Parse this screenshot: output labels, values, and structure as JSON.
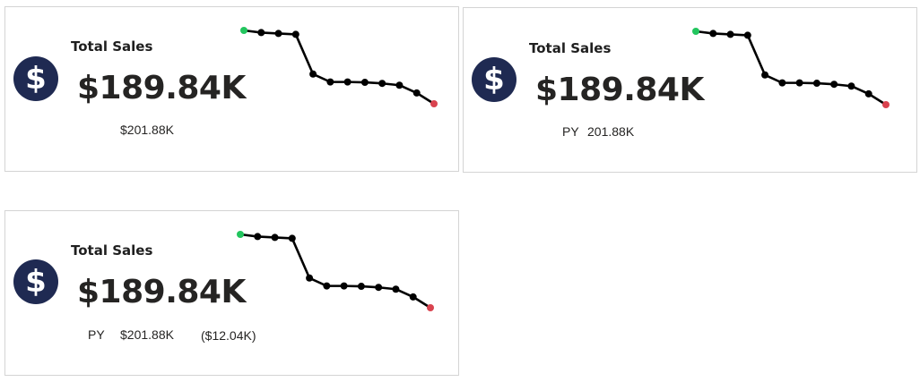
{
  "colors": {
    "icon_bg": "#1f2a52",
    "line": "#000000",
    "first_point": "#22c55e",
    "last_point": "#d9434f"
  },
  "cards": [
    {
      "icon": "dollar-icon",
      "icon_glyph": "$",
      "title": "Total Sales",
      "value": "$189.84K",
      "py_label": "",
      "py_value": "$201.88K",
      "variance": "",
      "sparkline": [
        100,
        98.8,
        98.3,
        97.8,
        75.8,
        71.4,
        71.4,
        71.2,
        70.6,
        69.6,
        65.3,
        59.3
      ]
    },
    {
      "icon": "dollar-icon",
      "icon_glyph": "$",
      "title": "Total Sales",
      "value": "$189.84K",
      "py_label": "PY",
      "py_value": "201.88K",
      "variance": "",
      "sparkline": [
        100,
        98.8,
        98.3,
        97.8,
        75.8,
        71.4,
        71.4,
        71.2,
        70.6,
        69.6,
        65.3,
        59.3
      ]
    },
    {
      "icon": "dollar-icon",
      "icon_glyph": "$",
      "title": "Total Sales",
      "value": "$189.84K",
      "py_label": "PY",
      "py_value": "$201.88K",
      "variance": "($12.04K)",
      "sparkline": [
        100,
        98.8,
        98.3,
        97.8,
        75.8,
        71.4,
        71.4,
        71.2,
        70.6,
        69.6,
        65.3,
        59.3
      ]
    }
  ]
}
